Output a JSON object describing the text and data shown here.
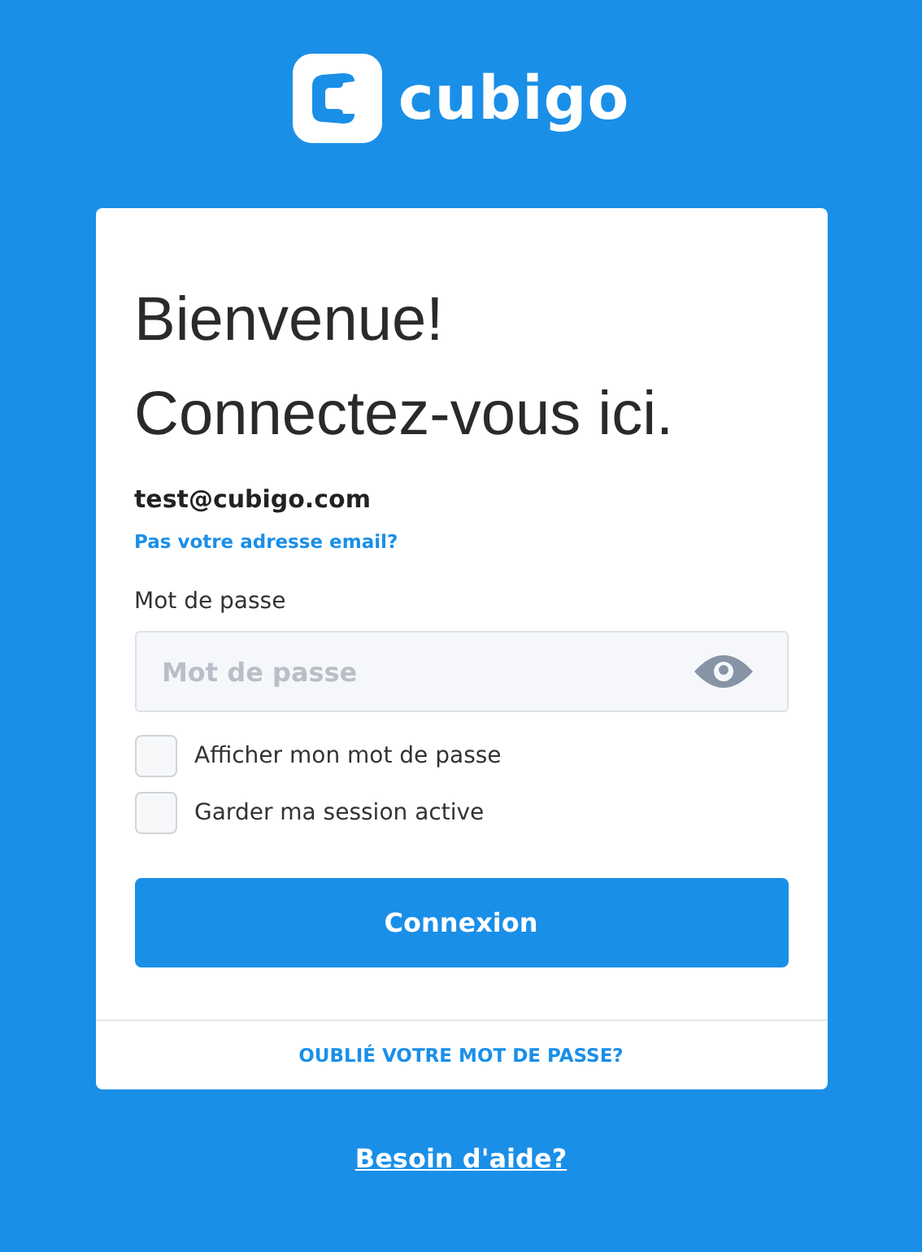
{
  "logo": {
    "text": "cubigo"
  },
  "card": {
    "heading": [
      "Bienvenue!",
      "Connectez-vous ici."
    ],
    "email": "test@cubigo.com",
    "change_email_link": "Pas votre adresse email?",
    "password": {
      "label": "Mot de passe",
      "placeholder": "Mot de passe"
    },
    "options": [
      {
        "label": "Afficher mon mot de passe",
        "checked": false
      },
      {
        "label": "Garder ma session active",
        "checked": false
      }
    ],
    "submit": "Connexion",
    "forgot_link": "OUBLIÉ VOTRE MOT DE PASSE?"
  },
  "help_link": "Besoin d'aide?"
}
